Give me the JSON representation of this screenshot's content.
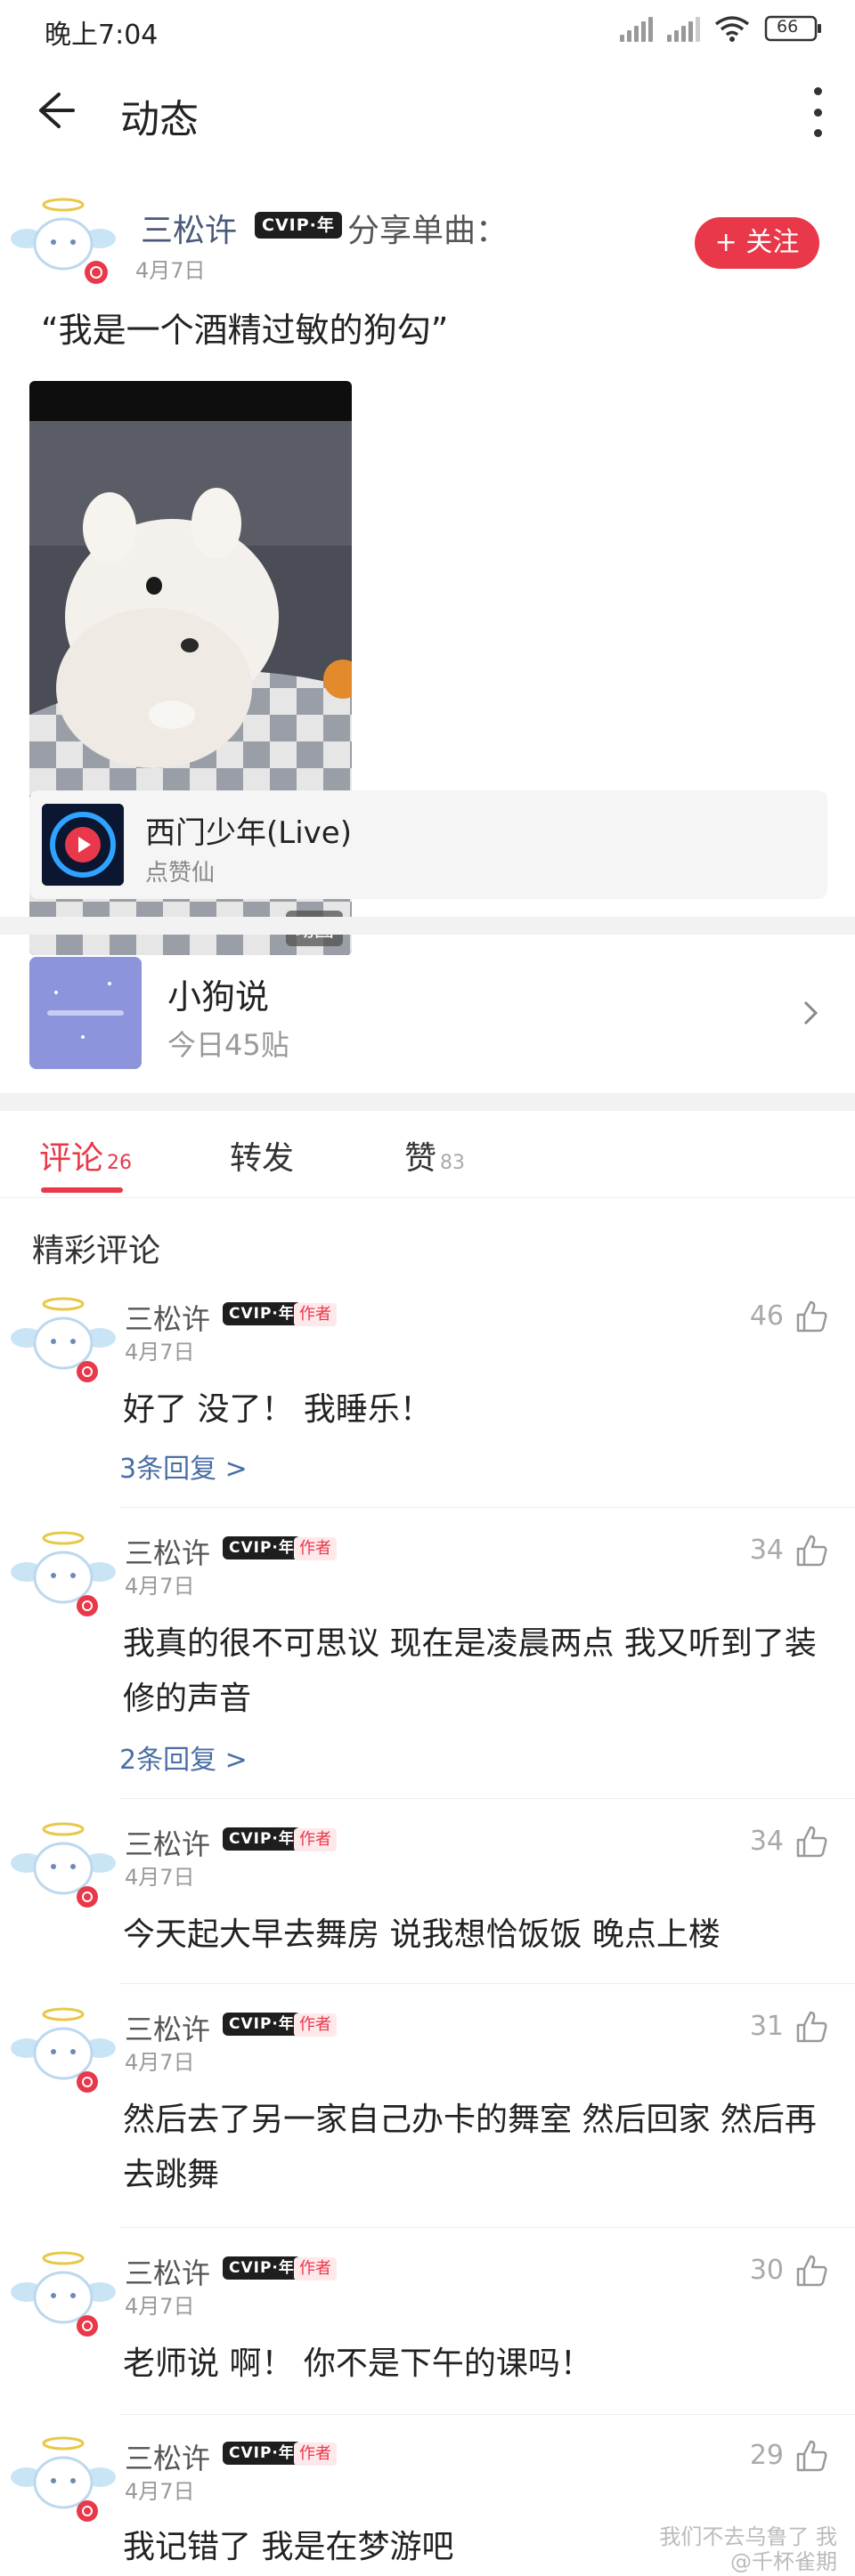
{
  "status_bar": {
    "time": "晚上7:04",
    "battery": "66"
  },
  "header": {
    "title": "动态"
  },
  "post": {
    "author": "三松许",
    "vip_label": "CVIP·年",
    "share_text": "分享单曲：",
    "date": "4月7日",
    "follow_label": "+ 关注",
    "text": "“我是一个酒精过敏的狗勾”",
    "gif_label": "动图",
    "song": {
      "title": "西门少年(Live)",
      "artist": "点赞仙"
    }
  },
  "topic": {
    "title": "小狗说",
    "stats": "今日45贴"
  },
  "tabs": [
    {
      "label": "评论",
      "count": "26"
    },
    {
      "label": "转发",
      "count": ""
    },
    {
      "label": "赞",
      "count": "83"
    }
  ],
  "section_title": "精彩评论",
  "comments": [
    {
      "name": "三松许",
      "vip": "CVIP·年",
      "tag": "作者",
      "date": "4月7日",
      "likes": "46",
      "text": "好了 没了！ 我睡乐！",
      "replies": "3条回复 >"
    },
    {
      "name": "三松许",
      "vip": "CVIP·年",
      "tag": "作者",
      "date": "4月7日",
      "likes": "34",
      "text": "我真的很不可思议 现在是凌晨两点 我又听到了装修的声音",
      "replies": "2条回复 >"
    },
    {
      "name": "三松许",
      "vip": "CVIP·年",
      "tag": "作者",
      "date": "4月7日",
      "likes": "34",
      "text": "今天起大早去舞房 说我想恰饭饭 晚点上楼",
      "replies": ""
    },
    {
      "name": "三松许",
      "vip": "CVIP·年",
      "tag": "作者",
      "date": "4月7日",
      "likes": "31",
      "text": "然后去了另一家自己办卡的舞室 然后回家 然后再去跳舞",
      "replies": ""
    },
    {
      "name": "三松许",
      "vip": "CVIP·年",
      "tag": "作者",
      "date": "4月7日",
      "likes": "30",
      "text": "老师说 啊！ 你不是下午的课吗！",
      "replies": ""
    },
    {
      "name": "三松许",
      "vip": "CVIP·年",
      "tag": "作者",
      "date": "4月7日",
      "likes": "29",
      "text": "我记错了 我是在梦游吧",
      "replies": ""
    }
  ],
  "watermark": {
    "line1": "我们不去乌鲁了 我",
    "line2": "@千杯雀期"
  },
  "icons": [
    "back-arrow-icon",
    "more-vertical-icon",
    "signal-icon",
    "wifi-icon",
    "battery-icon",
    "play-icon",
    "chevron-right-icon",
    "thumb-up-icon"
  ],
  "colors": {
    "accent": "#e8384a",
    "link": "#4a6ea5",
    "muted": "#999999"
  }
}
